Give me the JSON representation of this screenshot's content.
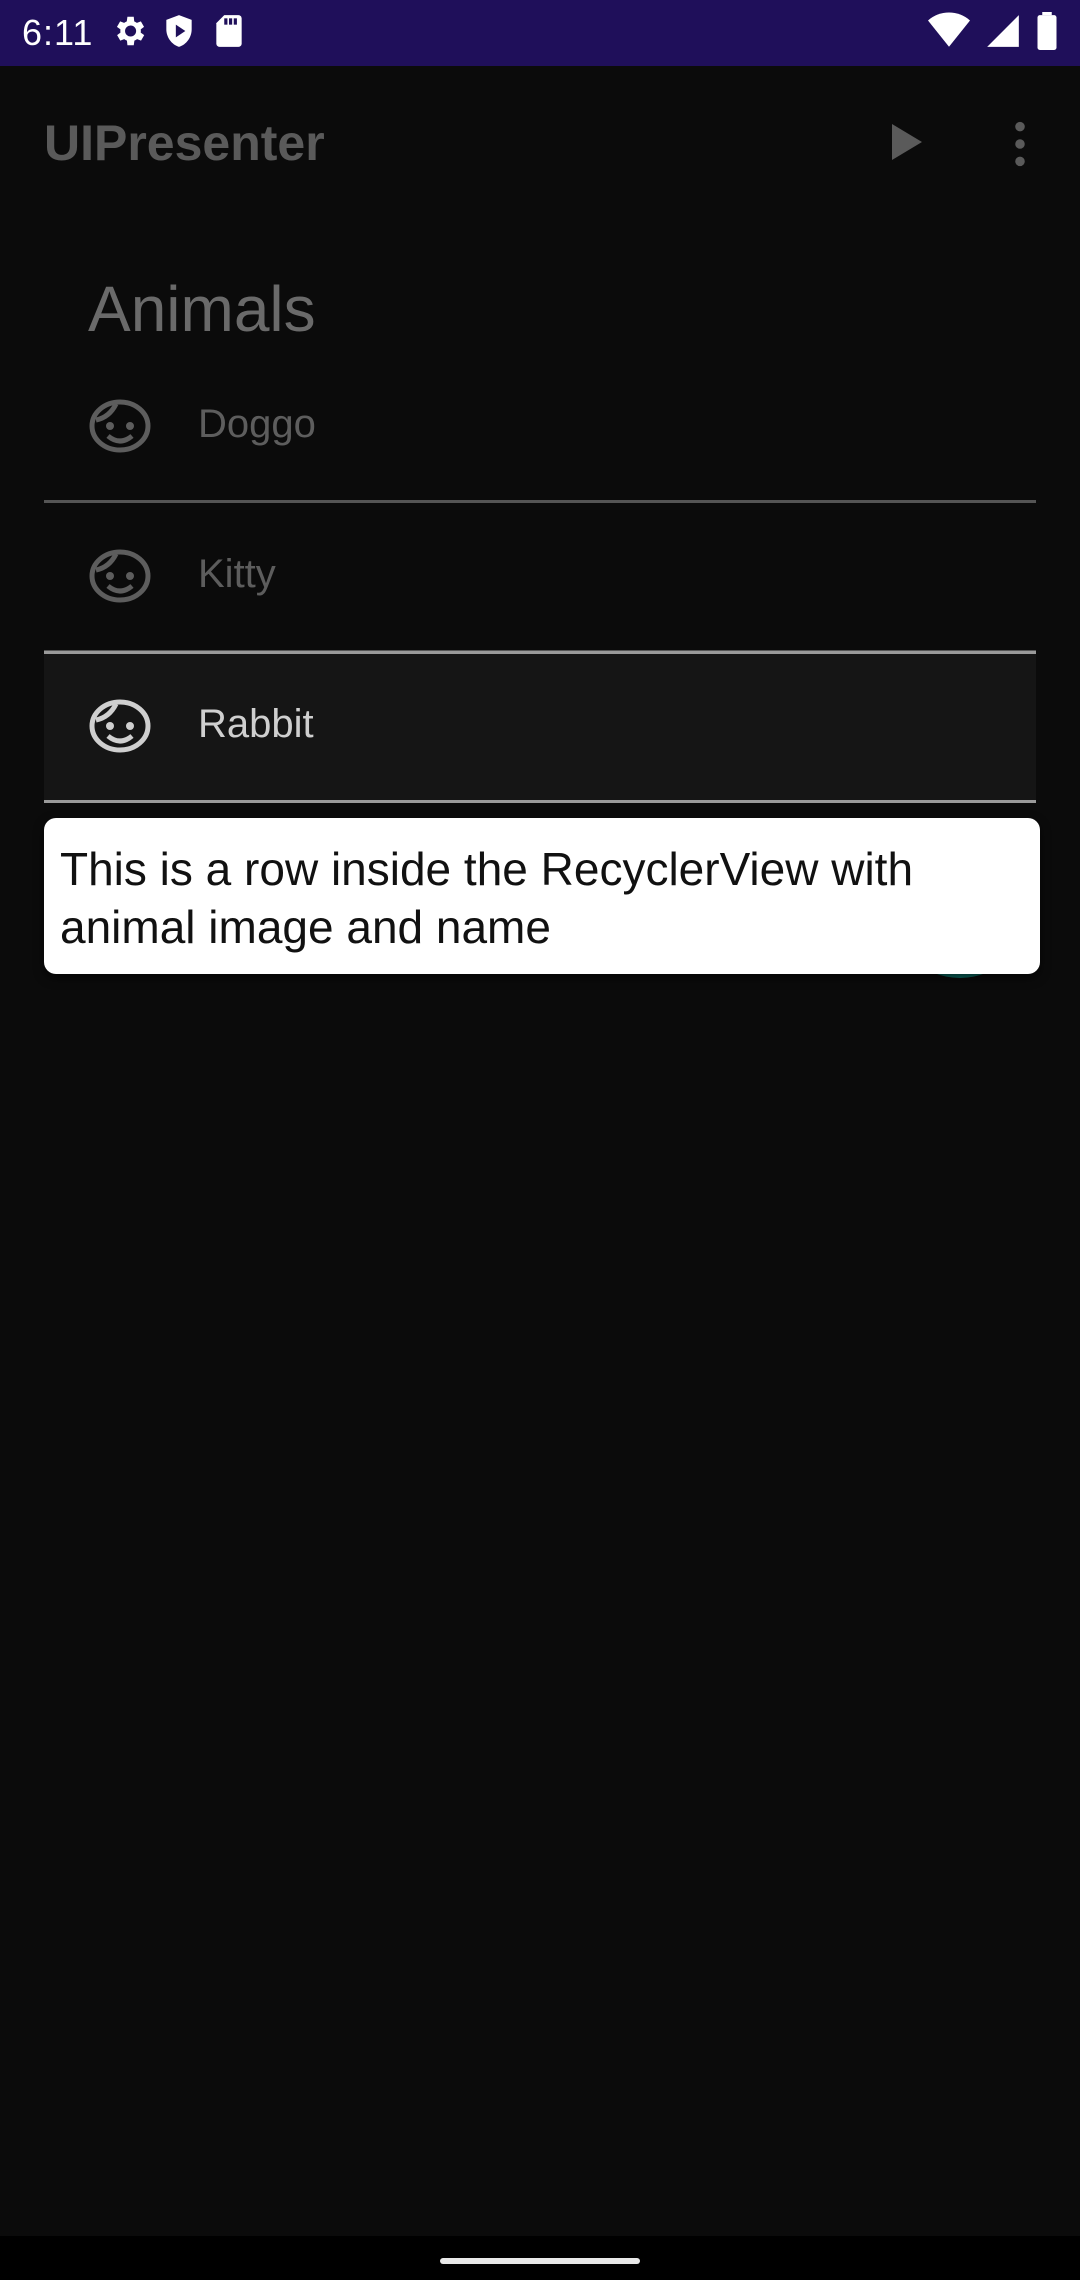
{
  "status_bar": {
    "time": "6:11",
    "icons": [
      "settings-icon",
      "shield-icon",
      "sd-card-icon",
      "wifi-icon",
      "signal-icon",
      "battery-icon"
    ]
  },
  "app_bar": {
    "title": "UIPresenter",
    "actions": [
      "play-icon",
      "more-vert-icon"
    ]
  },
  "main": {
    "heading": "Animals",
    "rows": [
      {
        "label": "Doggo",
        "icon": "face-icon"
      },
      {
        "label": "Kitty",
        "icon": "face-icon"
      },
      {
        "label": "Rabbit",
        "icon": "face-icon"
      }
    ],
    "highlighted_row": 2
  },
  "tooltip": {
    "text": "This is a row inside the RecyclerView with animal image and name"
  },
  "colors": {
    "status_bar": "#1f0f5a",
    "background": "#0b0b0b",
    "fab": "#0a6b62",
    "tooltip_bg": "#ffffff"
  }
}
